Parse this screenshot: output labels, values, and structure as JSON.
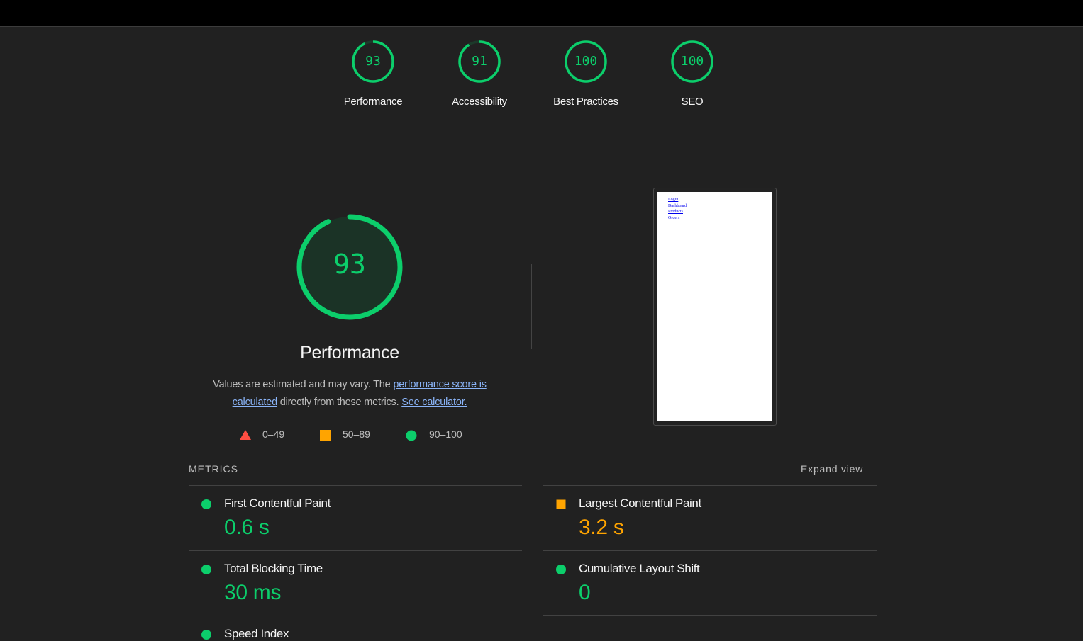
{
  "categories": [
    {
      "score": "93",
      "label": "Performance",
      "fraction": 0.93
    },
    {
      "score": "91",
      "label": "Accessibility",
      "fraction": 0.91
    },
    {
      "score": "100",
      "label": "Best Practices",
      "fraction": 1.0
    },
    {
      "score": "100",
      "label": "SEO",
      "fraction": 1.0
    }
  ],
  "performance": {
    "score": "93",
    "fraction": 0.93,
    "title": "Performance",
    "desc_prefix": "Values are estimated and may vary. The ",
    "desc_link1": "performance score is calculated",
    "desc_middle": " directly from these metrics. ",
    "desc_link2": "See calculator."
  },
  "legend": [
    {
      "shape": "triangle",
      "color": "#ff4e42",
      "range": "0–49"
    },
    {
      "shape": "square",
      "color": "#ffa400",
      "range": "50–89"
    },
    {
      "shape": "circle",
      "color": "#0cce6b",
      "range": "90–100"
    }
  ],
  "screenshot_links": [
    "Login",
    "Dashboard",
    "Products",
    "Orders"
  ],
  "metrics_header": "METRICS",
  "expand_view": "Expand view",
  "metrics": [
    {
      "name": "First Contentful Paint",
      "value": "0.6 s",
      "rating": "pass",
      "icon": "circle-icon"
    },
    {
      "name": "Largest Contentful Paint",
      "value": "3.2 s",
      "rating": "average",
      "icon": "square-icon"
    },
    {
      "name": "Total Blocking Time",
      "value": "30 ms",
      "rating": "pass",
      "icon": "circle-icon"
    },
    {
      "name": "Cumulative Layout Shift",
      "value": "0",
      "rating": "pass",
      "icon": "circle-icon"
    },
    {
      "name": "Speed Index",
      "value": "",
      "rating": "pass",
      "icon": "circle-icon"
    }
  ],
  "colors": {
    "pass": "#0cce6b",
    "average": "#ffa400",
    "fail": "#ff4e42",
    "background": "#212121"
  }
}
